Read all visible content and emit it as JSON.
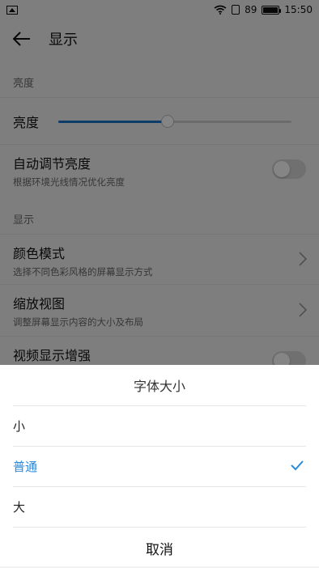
{
  "status_bar": {
    "battery": "89",
    "time": "15:50"
  },
  "app_bar": {
    "title": "显示"
  },
  "sections": {
    "brightness_header": "亮度",
    "display_header": "显示"
  },
  "settings": {
    "brightness": {
      "label": "亮度",
      "level_fraction": 0.47
    },
    "auto_brightness": {
      "title": "自动调节亮度",
      "subtitle": "根据环境光线情况优化亮度",
      "enabled": false
    },
    "color_mode": {
      "title": "颜色模式",
      "subtitle": "选择不同色彩风格的屏幕显示方式"
    },
    "zoom_view": {
      "title": "缩放视图",
      "subtitle": "调整屏幕显示内容的大小及布局"
    },
    "video_enhance": {
      "title": "视频显示增强",
      "enabled": false
    }
  },
  "dialog": {
    "title": "字体大小",
    "options": [
      {
        "label": "小",
        "selected": false
      },
      {
        "label": "普通",
        "selected": true
      },
      {
        "label": "大",
        "selected": false
      }
    ],
    "cancel_label": "取消"
  },
  "colors": {
    "accent": "#1a73c9",
    "selected_text": "#2a8ad8"
  }
}
